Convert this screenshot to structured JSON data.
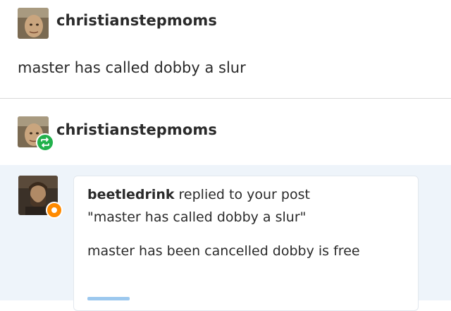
{
  "post1": {
    "username": "christianstepmoms",
    "body": "master has called dobby a slur"
  },
  "post2": {
    "username": "christianstepmoms"
  },
  "reply": {
    "user": "beetledrink",
    "action": " replied to your post",
    "quoted": "\"master has called dobby a slur\"",
    "text": "master has been cancelled dobby is free"
  },
  "colors": {
    "reblog_badge": "#22b14c",
    "reply_badge": "#ff8a00",
    "reply_background": "#eef4fa"
  },
  "icons": {
    "reblog": "reblog-icon",
    "reply": "reply-badge-icon"
  }
}
